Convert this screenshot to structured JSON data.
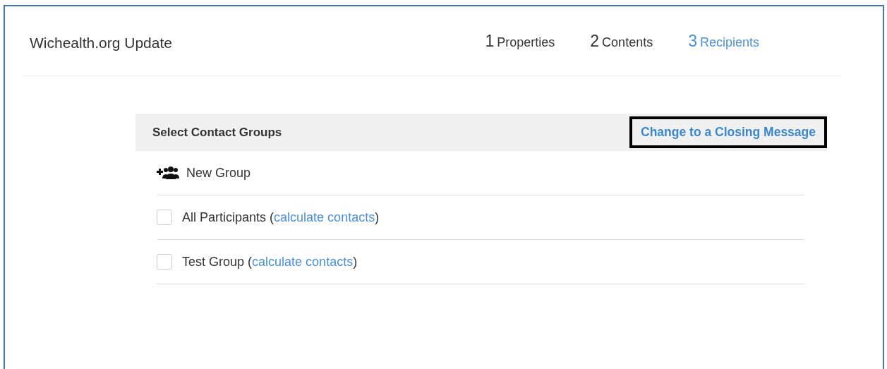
{
  "title": "Wichealth.org Update",
  "steps": [
    {
      "number": "1",
      "label": "Properties",
      "selected": false
    },
    {
      "number": "2",
      "label": "Contents",
      "selected": false
    },
    {
      "number": "3",
      "label": "Recipients",
      "selected": true
    }
  ],
  "panel": {
    "heading": "Select Contact Groups",
    "action": "Change to a Closing Message"
  },
  "new_group": "New Group",
  "groups": [
    {
      "name": "All Participants",
      "open": "(",
      "link": "calculate contacts",
      "close": ")",
      "checked": false
    },
    {
      "name": "Test Group",
      "open": "(",
      "link": "calculate contacts",
      "close": ")",
      "checked": false
    }
  ]
}
